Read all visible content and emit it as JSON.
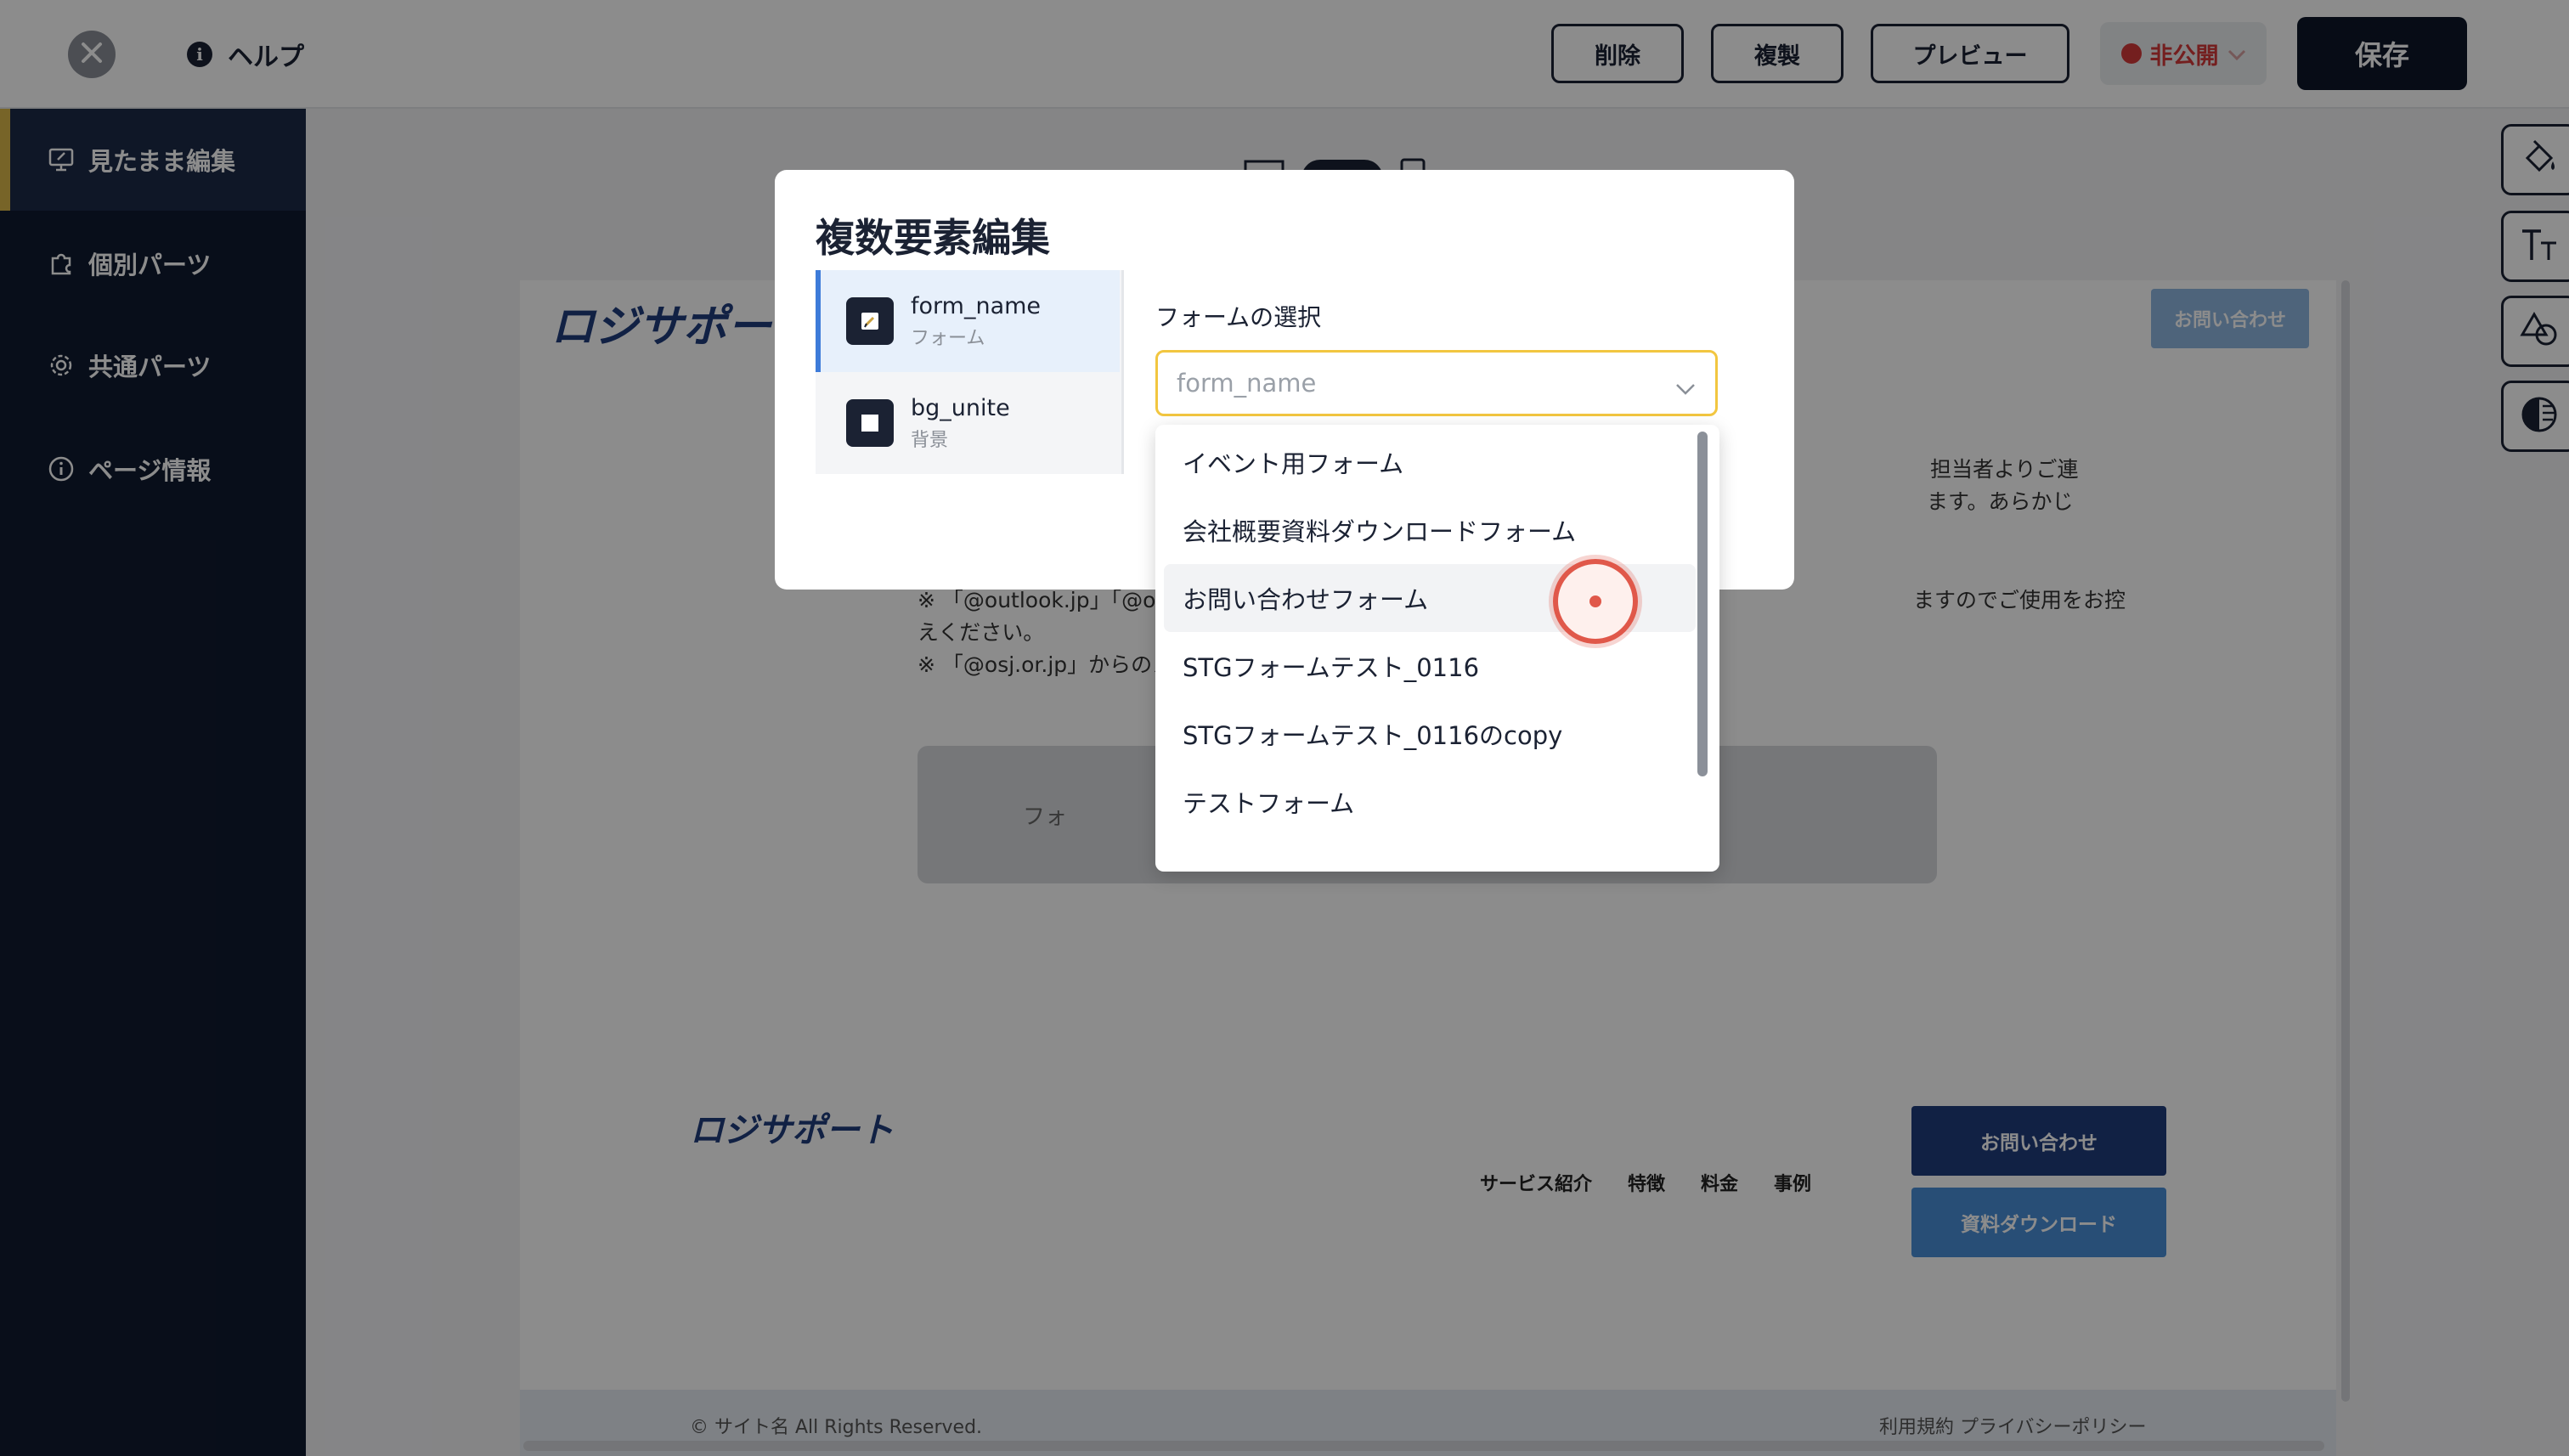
{
  "topbar": {
    "help_label": "ヘルプ",
    "delete_label": "削除",
    "duplicate_label": "複製",
    "preview_label": "プレビュー",
    "visibility_label": "非公開",
    "save_label": "保存"
  },
  "sidebar": {
    "items": [
      {
        "label": "見たまま編集",
        "icon": "monitor-edit-icon",
        "active": true
      },
      {
        "label": "個別パーツ",
        "icon": "puzzle-icon",
        "active": false
      },
      {
        "label": "共通パーツ",
        "icon": "settings-gear-icon",
        "active": false
      },
      {
        "label": "ページ情報",
        "icon": "info-circle-icon",
        "active": false
      }
    ]
  },
  "canvas": {
    "logo_text": "ロジサポート",
    "header_button": "お問い合わせ",
    "body_line1_right": "担当者よりご連",
    "body_line2_right": "ます。あらかじ",
    "note1": "※ 「@outlook.jp」「@ou",
    "note1_right": "ますのでご使用をお控",
    "note1_cont": "えください。",
    "note2": "※ 「@osj.or.jp」からのメ",
    "form_placeholder": "フォ",
    "footer_logo": "ロジサポート",
    "footer_nav": [
      "サービス紹介",
      "特徴",
      "料金",
      "事例"
    ],
    "footer_contact": "お問い合わせ",
    "footer_download": "資料ダウンロード",
    "copyright": "© サイト名 All Rights Reserved.",
    "footer_links": "利用規約 プライバシーポリシー"
  },
  "tools": [
    "paint-bucket-icon",
    "text-size-icon",
    "shapes-icon",
    "contrast-icon"
  ],
  "modal": {
    "title": "複数要素編集",
    "elements": [
      {
        "name": "form_name",
        "sub": "フォーム",
        "icon": "form-edit-icon"
      },
      {
        "name": "bg_unite",
        "sub": "背景",
        "icon": "background-square-icon"
      }
    ],
    "form_select_label": "フォームの選択",
    "select_placeholder": "form_name",
    "options": [
      "イベント用フォーム",
      "会社概要資料ダウンロードフォーム",
      "お問い合わせフォーム",
      "STGフォームテスト_0116",
      "STGフォームテスト_0116のcopy",
      "テストフォーム"
    ],
    "hovered_option": "お問い合わせフォーム"
  },
  "colors": {
    "navy": "#101a30",
    "accent_gold": "#d9b64a",
    "status_red": "#d43a3a",
    "select_border": "#f2c640",
    "selected_blue": "#3d7bd9"
  }
}
